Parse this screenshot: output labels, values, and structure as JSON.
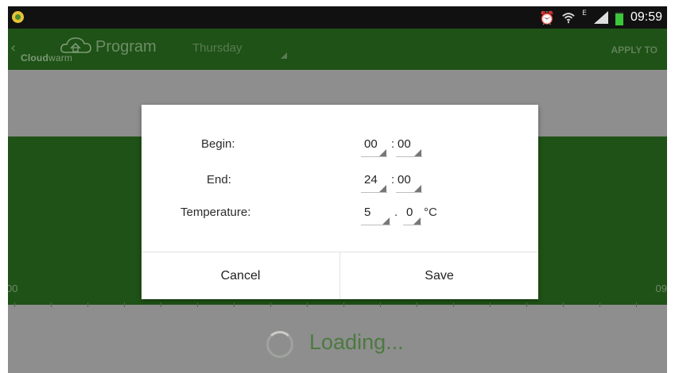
{
  "status_bar": {
    "time": "09:59",
    "network_type": "E",
    "icons": [
      "app-notification-icon",
      "alarm-icon",
      "wifi-icon",
      "signal-icon",
      "battery-icon"
    ]
  },
  "action_bar": {
    "logo_text_bold": "Cloud",
    "logo_text_thin": "warm",
    "title": "Program",
    "day": "Thursday",
    "apply_label": "APPLY TO"
  },
  "chart": {
    "axis_start": "00",
    "axis_end": "09"
  },
  "loading": {
    "text": "Loading..."
  },
  "dialog": {
    "begin": {
      "label": "Begin:",
      "hour": "00",
      "minute": "00"
    },
    "end": {
      "label": "End:",
      "hour": "24",
      "minute": "00"
    },
    "temperature": {
      "label": "Temperature:",
      "integer": "5",
      "decimal": "0",
      "unit": "°C"
    },
    "time_separator": ":",
    "decimal_separator": ".",
    "cancel_label": "Cancel",
    "save_label": "Save"
  },
  "colors": {
    "accent_green": "#1f5216",
    "dim_gray": "#8e8e8e",
    "loading_green": "#4c7a40",
    "battery_green": "#3cc63a"
  }
}
